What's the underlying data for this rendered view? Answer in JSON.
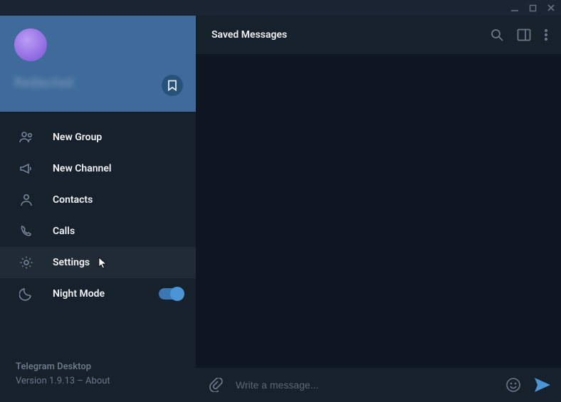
{
  "header": {
    "title": "Saved Messages"
  },
  "profile": {
    "display_name": "Redacted"
  },
  "sidebar": {
    "items": [
      {
        "label": "New Group"
      },
      {
        "label": "New Channel"
      },
      {
        "label": "Contacts"
      },
      {
        "label": "Calls"
      },
      {
        "label": "Settings"
      },
      {
        "label": "Night Mode"
      }
    ]
  },
  "night_mode": {
    "enabled": true
  },
  "footer": {
    "app_name": "Telegram Desktop",
    "version_line": "Version 1.9.13 – ",
    "about_label": "About"
  },
  "composer": {
    "placeholder": "Write a message..."
  }
}
